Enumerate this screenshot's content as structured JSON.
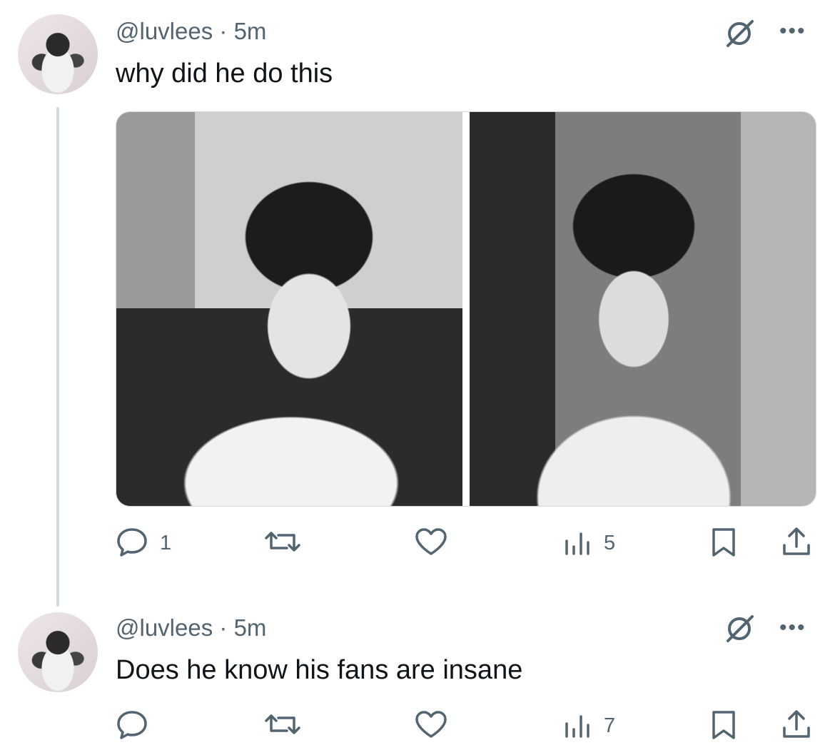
{
  "posts": [
    {
      "handle": "@luvlees",
      "time": "5m",
      "text": "why did he do this",
      "actions": {
        "replies": "1",
        "reposts": "",
        "likes": "",
        "views": "5"
      }
    },
    {
      "handle": "@luvlees",
      "time": "5m",
      "text": "Does he know his fans are insane",
      "actions": {
        "replies": "",
        "reposts": "",
        "likes": "",
        "views": "7"
      }
    }
  ],
  "separator": "·",
  "colors": {
    "muted": "#536471",
    "text": "#0f1419",
    "line": "#cfd9de"
  },
  "icons": [
    "avatar",
    "grok-icon",
    "more-icon",
    "reply-icon",
    "repost-icon",
    "like-icon",
    "views-icon",
    "bookmark-icon",
    "share-icon"
  ]
}
